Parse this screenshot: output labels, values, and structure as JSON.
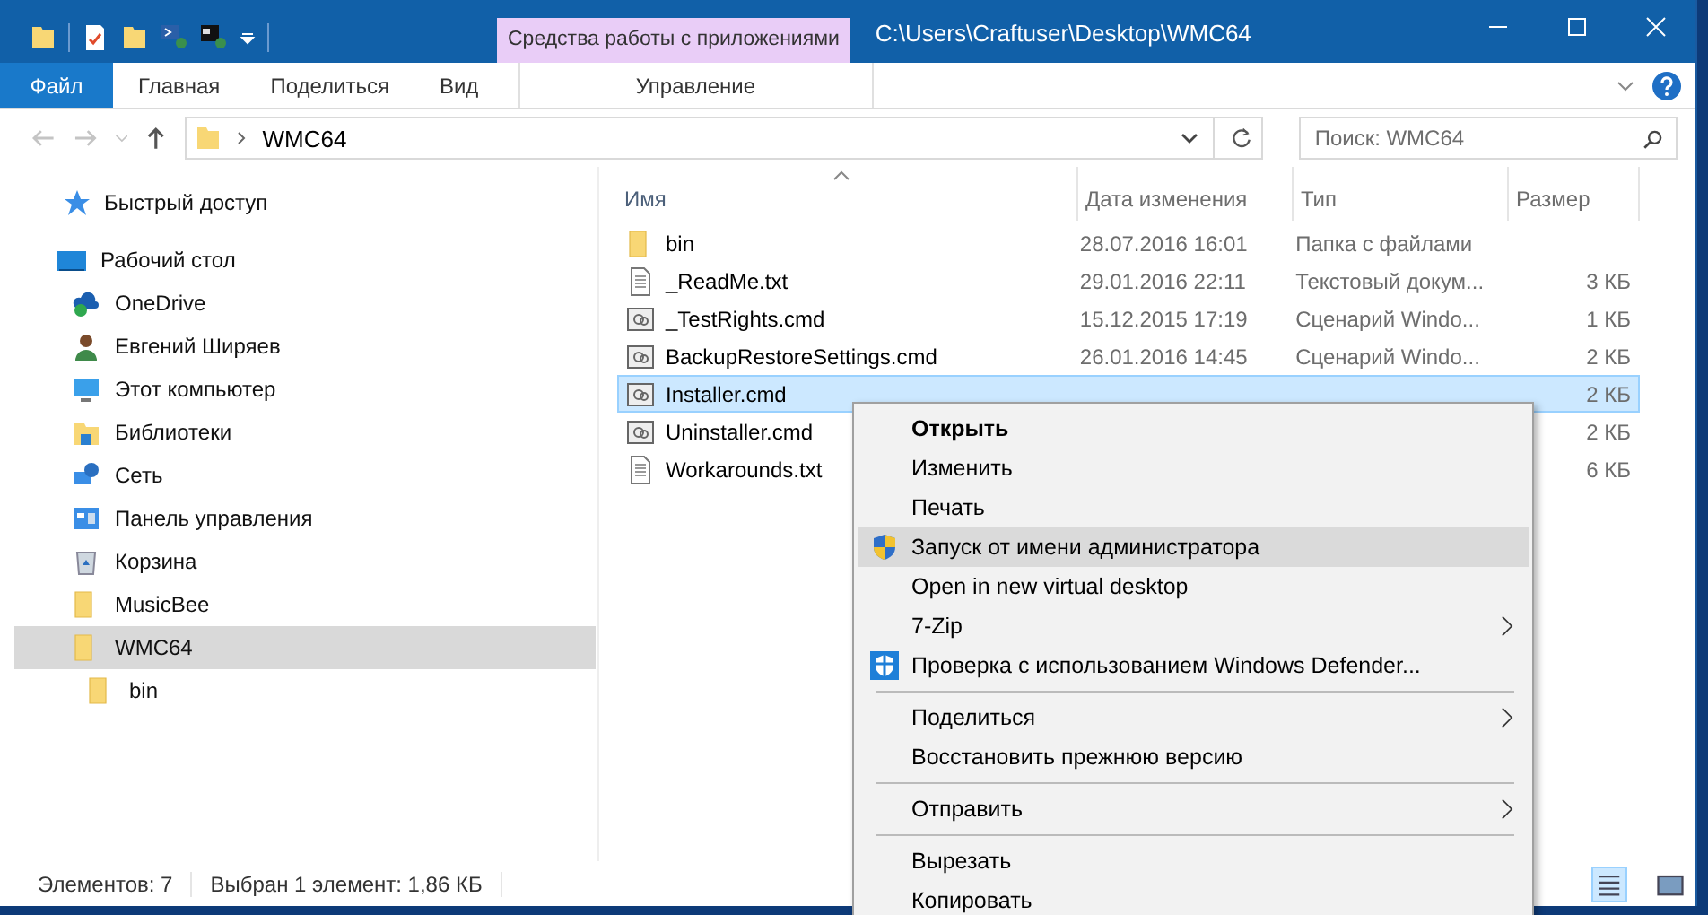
{
  "window": {
    "title": "C:\\Users\\Craftuser\\Desktop\\WMC64",
    "context_tab_group": "Средства работы с приложениями"
  },
  "ribbon_tabs": [
    {
      "label": "Файл",
      "kind": "file",
      "selected": false
    },
    {
      "label": "Главная",
      "kind": "normal",
      "selected": false
    },
    {
      "label": "Поделиться",
      "kind": "normal",
      "selected": false
    },
    {
      "label": "Вид",
      "kind": "normal",
      "selected": false
    },
    {
      "label": "Управление",
      "kind": "context",
      "selected": false
    }
  ],
  "address_bar": {
    "path_segment": "WMC64"
  },
  "search": {
    "placeholder": "Поиск: WMC64"
  },
  "navigation": [
    {
      "label": "Быстрый доступ",
      "kind": "star",
      "selected": false
    },
    {
      "label": "Рабочий стол",
      "kind": "desktop",
      "selected": false,
      "children": [
        {
          "label": "OneDrive",
          "kind": "cloud",
          "selected": false
        },
        {
          "label": "Евгений Ширяев",
          "kind": "user",
          "selected": false
        },
        {
          "label": "Этот компьютер",
          "kind": "computer",
          "selected": false
        },
        {
          "label": "Библиотеки",
          "kind": "library",
          "selected": false
        },
        {
          "label": "Сеть",
          "kind": "network",
          "selected": false
        },
        {
          "label": "Панель управления",
          "kind": "control-panel",
          "selected": false
        },
        {
          "label": "Корзина",
          "kind": "recycle",
          "selected": false
        },
        {
          "label": "MusicBee",
          "kind": "folder",
          "selected": false
        },
        {
          "label": "WMC64",
          "kind": "folder",
          "selected": true,
          "children": [
            {
              "label": "bin",
              "kind": "folder",
              "selected": false
            }
          ]
        }
      ]
    }
  ],
  "file_list": {
    "columns": [
      "Имя",
      "Дата изменения",
      "Тип",
      "Размер"
    ],
    "rows": [
      {
        "name": "bin",
        "kind": "folder",
        "date": "28.07.2016 16:01",
        "type": "Папка с файлами",
        "selected": false
      },
      {
        "name": "_ReadMe.txt",
        "kind": "text",
        "date": "29.01.2016 22:11",
        "type": "Текстовый докум...",
        "size": "3 КБ",
        "selected": false
      },
      {
        "name": "_TestRights.cmd",
        "kind": "script",
        "date": "15.12.2015 17:19",
        "type": "Сценарий Windo...",
        "size": "1 КБ",
        "selected": false
      },
      {
        "name": "BackupRestoreSettings.cmd",
        "kind": "script",
        "date": "26.01.2016 14:45",
        "type": "Сценарий Windo...",
        "size": "2 КБ",
        "selected": false
      },
      {
        "name": "Installer.cmd",
        "kind": "script",
        "size": "2 КБ",
        "selected": true
      },
      {
        "name": "Uninstaller.cmd",
        "kind": "script",
        "size": "2 КБ",
        "selected": false
      },
      {
        "name": "Workarounds.txt",
        "kind": "text",
        "size": "6 КБ",
        "selected": false
      }
    ]
  },
  "context_menu": {
    "items": [
      {
        "kind": "item",
        "label": "Открыть",
        "bold": true,
        "highlighted": false
      },
      {
        "kind": "item",
        "label": "Изменить",
        "highlighted": false
      },
      {
        "kind": "item",
        "label": "Печать",
        "highlighted": false
      },
      {
        "kind": "admin",
        "label": "Запуск от имени администратора",
        "highlighted": true
      },
      {
        "kind": "item",
        "label": "Open in new virtual desktop",
        "highlighted": false
      },
      {
        "kind": "item",
        "label": "7-Zip",
        "submenu": true,
        "highlighted": false
      },
      {
        "kind": "scan",
        "label": "Проверка с использованием Windows Defender...",
        "highlighted": false
      },
      {
        "kind": "separator"
      },
      {
        "kind": "item",
        "label": "Поделиться",
        "submenu": true,
        "highlighted": false
      },
      {
        "kind": "item",
        "label": "Восстановить прежнюю версию",
        "highlighted": false
      },
      {
        "kind": "separator"
      },
      {
        "kind": "item",
        "label": "Отправить",
        "submenu": true,
        "highlighted": false
      },
      {
        "kind": "separator"
      },
      {
        "kind": "item",
        "label": "Вырезать",
        "highlighted": false
      },
      {
        "kind": "item",
        "label": "Копировать",
        "highlighted": false
      }
    ]
  },
  "status_bar": {
    "items_count": "Элементов: 7",
    "selection": "Выбран 1 элемент: 1,86 КБ"
  }
}
